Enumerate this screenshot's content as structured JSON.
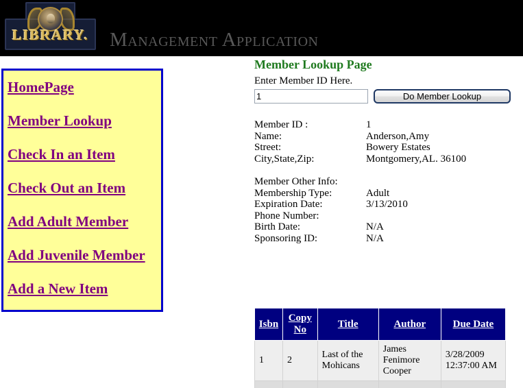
{
  "banner": {
    "logo_word": "LIBRARY.",
    "title": "Management Application"
  },
  "sidebar": {
    "items": [
      {
        "label": "HomePage"
      },
      {
        "label": "Member Lookup"
      },
      {
        "label": "Check In an Item"
      },
      {
        "label": "Check Out an Item"
      },
      {
        "label": "Add Adult Member"
      },
      {
        "label": "Add Juvenile Member"
      },
      {
        "label": "Add a New Item"
      }
    ]
  },
  "main": {
    "heading": "Member Lookup Page",
    "id_label": "Enter Member ID Here.",
    "member_id_value": "1",
    "member_id_placeholder": "",
    "lookup_button": "Do Member Lookup",
    "details": [
      {
        "label": "Member ID :",
        "value": "1"
      },
      {
        "label": "Name:",
        "value": "Anderson,Amy"
      },
      {
        "label": "Street:",
        "value": "Bowery Estates"
      },
      {
        "label": "City,State,Zip:",
        "value": "Montgomery,AL. 36100"
      }
    ],
    "other_info_heading": "Member Other Info:",
    "other_details": [
      {
        "label": "Membership Type:",
        "value": "Adult"
      },
      {
        "label": "Expiration Date:",
        "value": "3/13/2010"
      },
      {
        "label": "Phone Number:",
        "value": ""
      },
      {
        "label": "Birth Date:",
        "value": "N/A"
      },
      {
        "label": "Sponsoring ID:",
        "value": "N/A"
      }
    ]
  },
  "items_table": {
    "columns": [
      "Isbn",
      "Copy No",
      "Title",
      "Author",
      "Due Date"
    ],
    "rows": [
      {
        "isbn": "1",
        "copy_no": "2",
        "title": "Last of the Mohicans",
        "author": "James Fenimore Cooper",
        "due_date": "3/28/2009 12:37:00 AM"
      },
      {
        "isbn": "",
        "copy_no": "",
        "title": "",
        "author": "",
        "due_date": ""
      }
    ]
  },
  "colors": {
    "banner_background": "#000000",
    "banner_title": "#585858",
    "logo_gold": "#d9b95e",
    "sidebar_background": "#ffff99",
    "sidebar_border": "#0000cc",
    "nav_link": "#800080",
    "heading_green": "#1f7a1f",
    "table_header": "#000080",
    "button_border": "#1f3864"
  }
}
